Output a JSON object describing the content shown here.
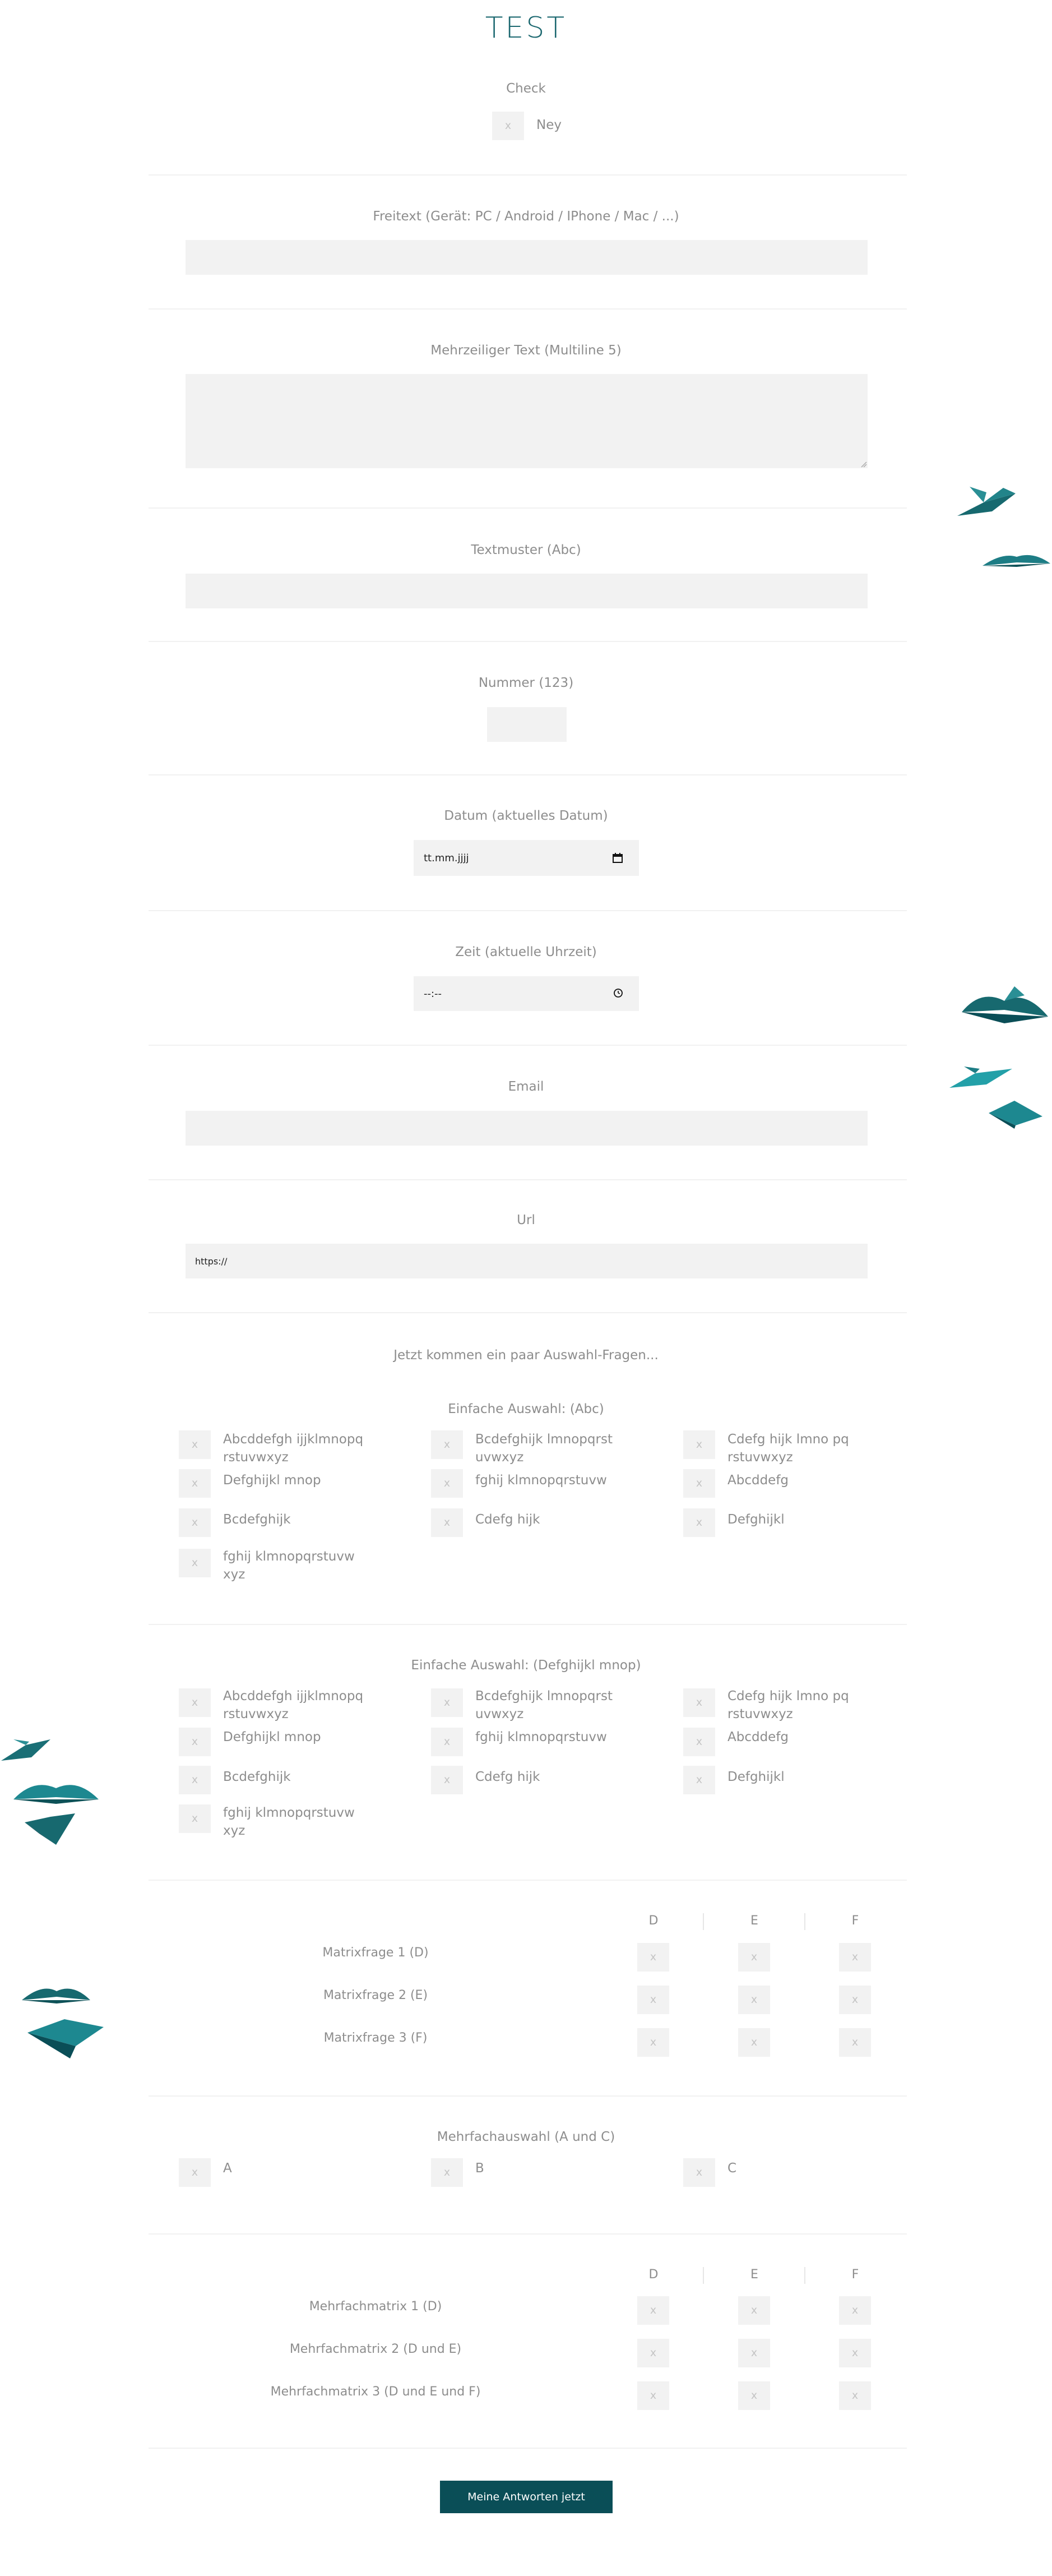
{
  "title": "TEST",
  "check": {
    "label": "Check",
    "box": "x",
    "option": "Ney"
  },
  "freitext": {
    "label": "Freitext (Gerät: PC / Android / IPhone / Mac / ...)"
  },
  "multiline": {
    "label": "Mehrzeiliger Text (Multiline 5)"
  },
  "textmuster": {
    "label": "Textmuster (Abc)"
  },
  "nummer": {
    "label": "Nummer (123)"
  },
  "datum": {
    "label": "Datum (aktuelles Datum)",
    "placeholder": "tt.mm.jjjj"
  },
  "zeit": {
    "label": "Zeit (aktuelle Uhrzeit)",
    "placeholder": "--:--"
  },
  "email": {
    "label": "Email"
  },
  "url": {
    "label": "Url",
    "value": "https://"
  },
  "intro": "Jetzt kommen ein paar Auswahl-Fragen...",
  "box_mark": "x",
  "einfach1": {
    "label": "Einfache Auswahl: (Abc)",
    "options": [
      [
        "Abcddefgh ijjklmnopq",
        "rstuvwxyz"
      ],
      [
        "Bcdefghijk lmnopqrst",
        "uvwxyz"
      ],
      [
        "Cdefg hijk lmno pq",
        "rstuvwxyz"
      ],
      [
        "Defghijkl mnop",
        ""
      ],
      [
        "fghij klmnopqrstuvw",
        ""
      ],
      [
        "Abcddefg",
        ""
      ],
      [
        "Bcdefghijk",
        ""
      ],
      [
        "Cdefg hijk",
        ""
      ],
      [
        "Defghijkl",
        ""
      ],
      [
        "fghij klmnopqrstuvw",
        "xyz"
      ]
    ]
  },
  "einfach2": {
    "label": "Einfache Auswahl: (Defghijkl mnop)",
    "options": [
      [
        "Abcddefgh ijjklmnopq",
        "rstuvwxyz"
      ],
      [
        "Bcdefghijk lmnopqrst",
        "uvwxyz"
      ],
      [
        "Cdefg hijk lmno pq",
        "rstuvwxyz"
      ],
      [
        "Defghijkl mnop",
        ""
      ],
      [
        "fghij klmnopqrstuvw",
        ""
      ],
      [
        "Abcddefg",
        ""
      ],
      [
        "Bcdefghijk",
        ""
      ],
      [
        "Cdefg hijk",
        ""
      ],
      [
        "Defghijkl",
        ""
      ],
      [
        "fghij klmnopqrstuvw",
        "xyz"
      ]
    ]
  },
  "matrix1": {
    "columns": [
      "D",
      "E",
      "F"
    ],
    "rows": [
      "Matrixfrage 1 (D)",
      "Matrixfrage 2 (E)",
      "Matrixfrage 3 (F)"
    ]
  },
  "mehrfach": {
    "label": "Mehrfachauswahl (A und C)",
    "options": [
      "A",
      "B",
      "C"
    ]
  },
  "matrix2": {
    "columns": [
      "D",
      "E",
      "F"
    ],
    "rows": [
      "Mehrfachmatrix 1 (D)",
      "Mehrfachmatrix 2 (D und E)",
      "Mehrfachmatrix 3 (D und E und F)"
    ]
  },
  "submit": "Meine Antworten jetzt absenden",
  "colors": {
    "accent": "#1c6870",
    "button": "#0a4e57",
    "field": "#f2f2f2",
    "book": "#1d7d85"
  }
}
